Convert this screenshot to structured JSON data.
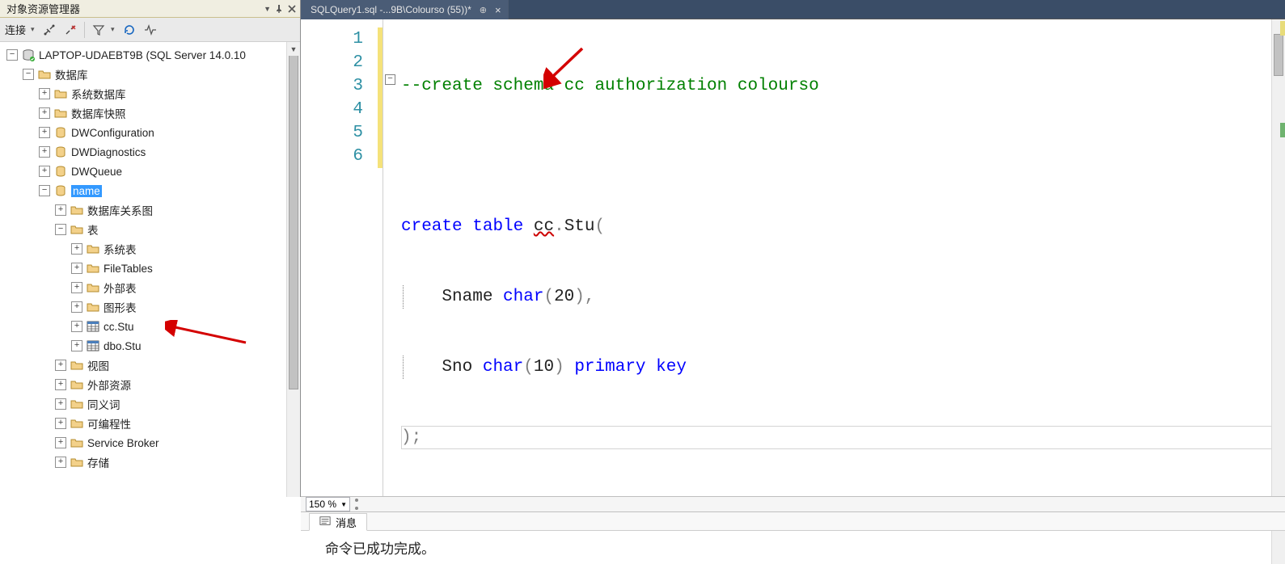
{
  "panel": {
    "title": "对象资源管理器",
    "connect_label": "连接"
  },
  "tree": {
    "server": "LAPTOP-UDAEBT9B (SQL Server 14.0.10",
    "databases": "数据库",
    "sys_db": "系统数据库",
    "snapshot": "数据库快照",
    "dwconfig": "DWConfiguration",
    "dwdiag": "DWDiagnostics",
    "dwqueue": "DWQueue",
    "name_db": "name",
    "diagrams": "数据库关系图",
    "tables": "表",
    "sys_tables": "系统表",
    "filetables": "FileTables",
    "ext_tables": "外部表",
    "graph_tables": "图形表",
    "cc_stu": "cc.Stu",
    "dbo_stu": "dbo.Stu",
    "views": "视图",
    "ext_res": "外部资源",
    "synonyms": "同义词",
    "programmability": "可编程性",
    "service_broker": "Service Broker",
    "storage": "存储"
  },
  "tab": {
    "title": "SQLQuery1.sql -...9B\\Colourso (55))*"
  },
  "code": {
    "l1_comment": "--create schema cc authorization colourso",
    "l3_create": "create",
    "l3_table": "table",
    "l3_cc": "cc",
    "l3_stu": "Stu",
    "l4_sname": "Sname",
    "l4_char": "char",
    "l4_20": "20",
    "l5_sno": "Sno",
    "l5_char": "char",
    "l5_10": "10",
    "l5_pk": "primary key"
  },
  "zoom": {
    "value": "150 %"
  },
  "messages": {
    "tab_label": "消息",
    "text": "命令已成功完成。"
  }
}
